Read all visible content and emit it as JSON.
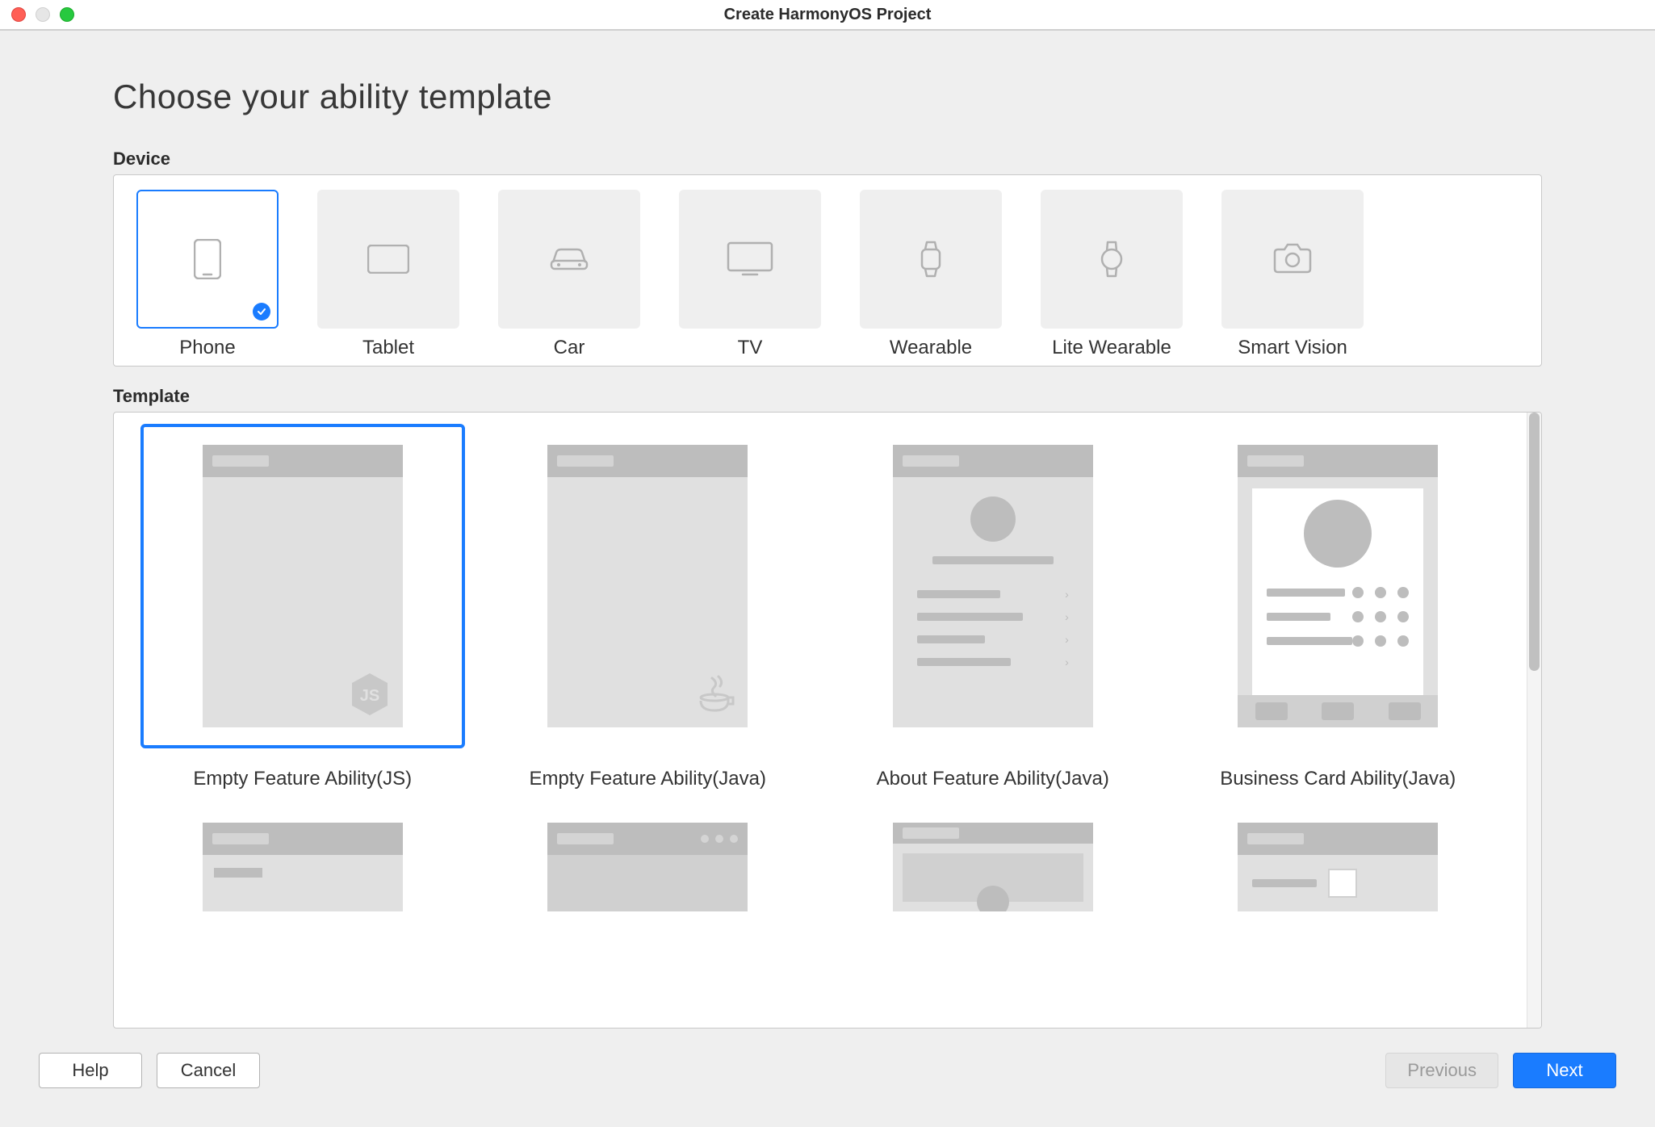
{
  "window": {
    "title": "Create HarmonyOS Project"
  },
  "page": {
    "heading": "Choose your ability template",
    "device_section_label": "Device",
    "template_section_label": "Template"
  },
  "devices": [
    {
      "label": "Phone",
      "selected": true
    },
    {
      "label": "Tablet",
      "selected": false
    },
    {
      "label": "Car",
      "selected": false
    },
    {
      "label": "TV",
      "selected": false
    },
    {
      "label": "Wearable",
      "selected": false
    },
    {
      "label": "Lite Wearable",
      "selected": false
    },
    {
      "label": "Smart Vision",
      "selected": false
    }
  ],
  "templates": [
    {
      "label": "Empty Feature Ability(JS)",
      "selected": true
    },
    {
      "label": "Empty Feature Ability(Java)",
      "selected": false
    },
    {
      "label": "About Feature Ability(Java)",
      "selected": false
    },
    {
      "label": "Business Card Ability(Java)",
      "selected": false
    }
  ],
  "buttons": {
    "help": "Help",
    "cancel": "Cancel",
    "previous": "Previous",
    "next": "Next"
  }
}
